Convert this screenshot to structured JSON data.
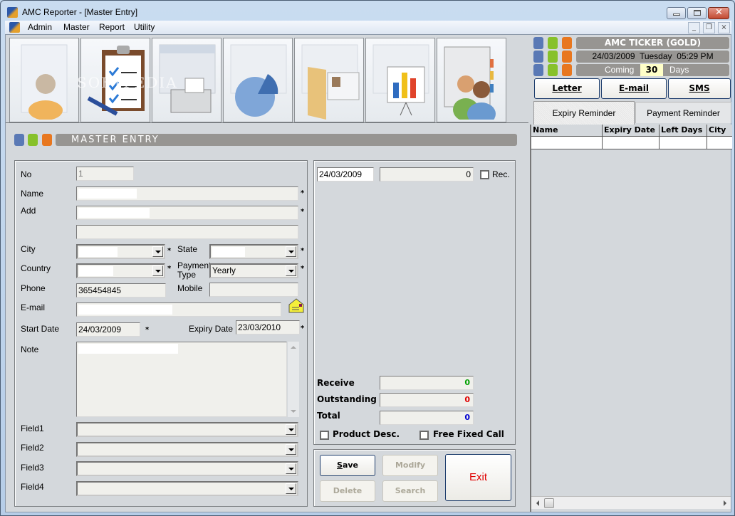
{
  "window": {
    "title": "AMC Reporter - [Master Entry]",
    "controls": {
      "minimize": "minimize",
      "maximize": "maximize",
      "close": "close"
    }
  },
  "menu": {
    "items": [
      {
        "label": "Admin"
      },
      {
        "label": "Master"
      },
      {
        "label": "Report"
      },
      {
        "label": "Utility"
      }
    ],
    "mdi_controls": {
      "minimize": "_",
      "restore": "❐",
      "close": "×"
    }
  },
  "toolbar": {
    "buttons": [
      {
        "name": "customer",
        "icon": "person-notebook-icon"
      },
      {
        "name": "checklist",
        "icon": "clipboard-checklist-icon"
      },
      {
        "name": "fax",
        "icon": "calendar-fax-icon"
      },
      {
        "name": "chart",
        "icon": "calendar-pie-chart-icon"
      },
      {
        "name": "folder",
        "icon": "contact-folder-icon"
      },
      {
        "name": "presentation",
        "icon": "presentation-chart-icon"
      },
      {
        "name": "contacts",
        "icon": "address-book-people-icon"
      }
    ],
    "watermark": "SOFTPEDIA"
  },
  "ticker": {
    "title": "AMC TICKER (GOLD)",
    "datetime": "24/03/2009  Tuesday  05:29 PM",
    "coming_label": "Coming",
    "coming_days": "30",
    "days_label": "Days",
    "colors": {
      "blue": "#5a79b5",
      "green": "#87c12a",
      "orange": "#e8771f"
    }
  },
  "actions": {
    "letter": "Letter",
    "email": "E-mail",
    "sms": "SMS"
  },
  "reminder_tabs": [
    {
      "label": "Expiry Reminder",
      "active": true
    },
    {
      "label": "Payment Reminder",
      "active": false
    }
  ],
  "reminder_grid": {
    "columns": [
      "Name",
      "Expiry Date",
      "Left Days",
      "City"
    ],
    "rows": [
      [
        "",
        "",
        "",
        ""
      ]
    ]
  },
  "master_entry": {
    "header": "MASTER ENTRY",
    "fields": {
      "no": {
        "label": "No",
        "value": "1"
      },
      "name": {
        "label": "Name",
        "value": ""
      },
      "add": {
        "label": "Add",
        "value": "",
        "value2": ""
      },
      "city": {
        "label": "City",
        "value": ""
      },
      "state": {
        "label": "State",
        "value": ""
      },
      "country": {
        "label": "Country",
        "value": ""
      },
      "payment_type": {
        "label": "Payment Type",
        "value": "Yearly"
      },
      "phone": {
        "label": "Phone",
        "value": "365454845"
      },
      "mobile": {
        "label": "Mobile",
        "value": ""
      },
      "email": {
        "label": "E-mail",
        "value": ""
      },
      "start_date": {
        "label": "Start Date",
        "value": "24/03/2009"
      },
      "expiry_date": {
        "label": "Expiry Date",
        "value": "23/03/2010"
      },
      "note": {
        "label": "Note",
        "value": ""
      },
      "field1": {
        "label": "Field1",
        "value": ""
      },
      "field2": {
        "label": "Field2",
        "value": ""
      },
      "field3": {
        "label": "Field3",
        "value": ""
      },
      "field4": {
        "label": "Field4",
        "value": ""
      }
    },
    "required_mark": "*"
  },
  "payment": {
    "date": "24/03/2009",
    "amount": "0",
    "rec_label": "Rec.",
    "receive_label": "Receive",
    "receive_value": "0",
    "outstanding_label": "Outstanding",
    "outstanding_value": "0",
    "total_label": "Total",
    "total_value": "0",
    "product_desc_label": "Product Desc.",
    "free_fixed_call_label": "Free Fixed Call",
    "colors": {
      "receive": "#00a000",
      "outstanding": "#e00000",
      "total": "#0000d0"
    }
  },
  "buttons": {
    "save": "Save",
    "modify": "Modify",
    "delete": "Delete",
    "search": "Search",
    "exit": "Exit"
  }
}
